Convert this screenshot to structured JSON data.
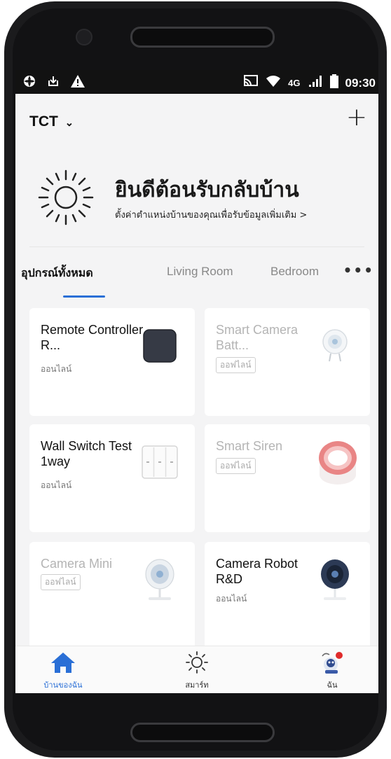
{
  "status_bar": {
    "left_icons": [
      "settings-icon",
      "download-icon",
      "warning-icon"
    ],
    "network": "4G",
    "time": "09:30"
  },
  "header": {
    "home_name": "TCT",
    "dropdown_glyph": "⌄",
    "add_glyph": "+"
  },
  "welcome": {
    "title": "ยินดีต้อนรับกลับบ้าน",
    "subtitle": "ตั้งค่าตำแหน่งบ้านของคุณเพื่อรับข้อมูลเพิ่มเติม >"
  },
  "tabs": {
    "items": [
      "อุปกรณ์ทั้งหมด",
      "Living Room",
      "Bedroom"
    ],
    "active_index": 0,
    "more_glyph": "•••"
  },
  "devices": [
    {
      "name": "Remote Controller R...",
      "status": "ออนไลน์",
      "online": true,
      "icon": "remote-controller-icon"
    },
    {
      "name": "Smart Camera Batt...",
      "status": "ออฟไลน์",
      "online": false,
      "icon": "smart-camera-icon"
    },
    {
      "name": "Wall Switch Test 1way",
      "status": "ออนไลน์",
      "online": true,
      "icon": "wall-switch-icon"
    },
    {
      "name": "Smart Siren",
      "status": "ออฟไลน์",
      "online": false,
      "icon": "siren-icon"
    },
    {
      "name": "Camera Mini",
      "status": "ออฟไลน์",
      "online": false,
      "icon": "camera-mini-icon"
    },
    {
      "name": "Camera Robot R&D",
      "status": "ออนไลน์",
      "online": true,
      "icon": "camera-robot-icon"
    }
  ],
  "bottom_nav": {
    "items": [
      {
        "label": "บ้านของฉัน",
        "icon": "home-icon",
        "active": true
      },
      {
        "label": "สมาร์ท",
        "icon": "smart-sun-icon",
        "active": false
      },
      {
        "label": "ฉัน",
        "icon": "profile-avatar-icon",
        "active": false
      }
    ]
  },
  "colors": {
    "accent": "#2a6fd6",
    "background": "#f4f4f5",
    "card": "#ffffff",
    "offline_text": "#b4b4b4"
  }
}
